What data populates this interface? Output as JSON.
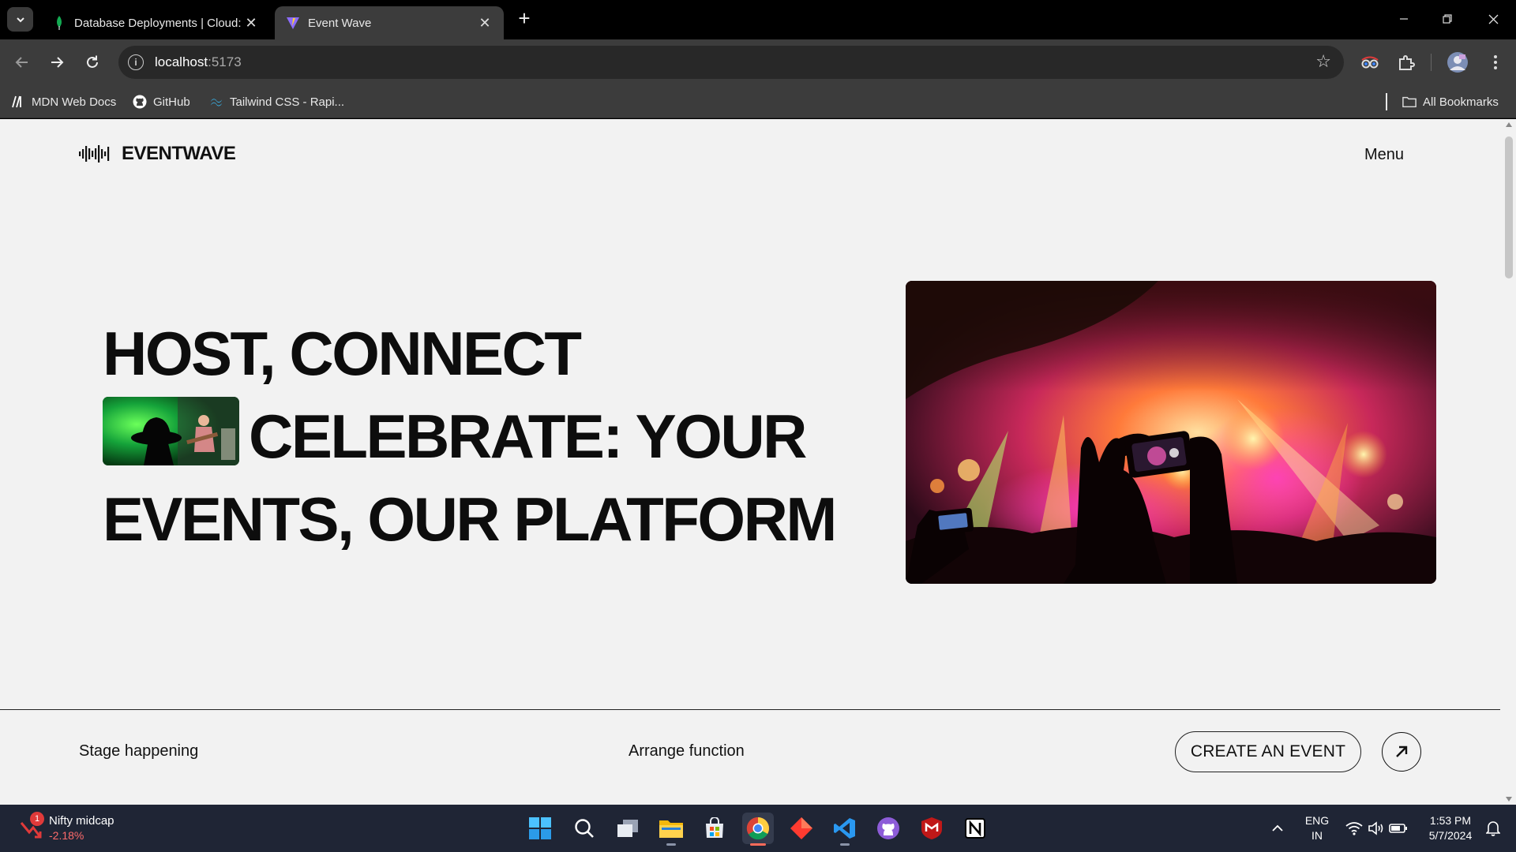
{
  "browser": {
    "tabs": [
      {
        "title": "Database Deployments | Cloud:",
        "icon": "mongodb-leaf-icon",
        "active": false
      },
      {
        "title": "Event Wave",
        "icon": "vite-icon",
        "active": true
      }
    ],
    "address": {
      "host": "localhost",
      "port": ":5173"
    },
    "bookmarks": [
      {
        "label": "MDN Web Docs",
        "icon": "mdn-icon"
      },
      {
        "label": "GitHub",
        "icon": "github-icon"
      },
      {
        "label": "Tailwind CSS - Rapi...",
        "icon": "tailwind-icon"
      }
    ],
    "all_bookmarks_label": "All Bookmarks"
  },
  "site": {
    "brand": "EVENTWAVE",
    "menu_label": "Menu",
    "hero": {
      "line1": "HOST, CONNECT",
      "line2": "CELEBRATE: YOUR",
      "line3": "EVENTS, OUR PLATFORM"
    },
    "footer": {
      "item1": "Stage happening",
      "item2": "Arrange function",
      "cta_label": "CREATE AN EVENT"
    }
  },
  "taskbar": {
    "widget": {
      "name": "Nifty midcap",
      "change": "-2.18%",
      "badge": "1"
    },
    "lang": {
      "line1": "ENG",
      "line2": "IN"
    },
    "clock": {
      "time": "1:53 PM",
      "date": "5/7/2024"
    },
    "apps": [
      "windows-start-icon",
      "search-icon",
      "task-view-icon",
      "file-explorer-icon",
      "microsoft-store-icon",
      "chrome-icon",
      "app-icon",
      "vscode-icon",
      "github-desktop-icon",
      "mcafee-icon",
      "notion-icon"
    ]
  },
  "colors": {
    "page_bg": "#f2f2f2",
    "text": "#0d0d0d",
    "chrome_dark": "#3c3c3c",
    "taskbar": "#1f2535"
  }
}
